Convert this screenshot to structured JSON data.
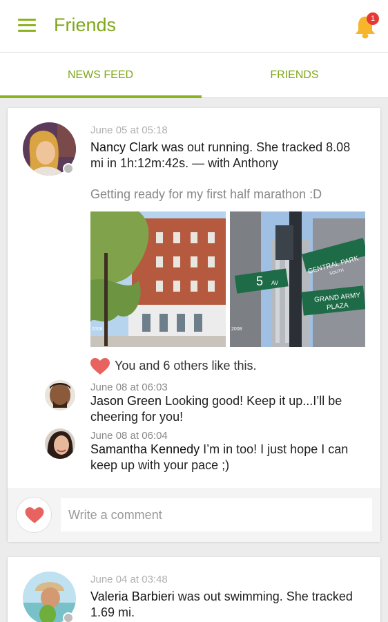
{
  "app": {
    "title": "Friends",
    "accent_color": "#8bb31f",
    "notification_count": "1"
  },
  "tabs": [
    {
      "label": "NEWS FEED",
      "active": true
    },
    {
      "label": "FRIENDS",
      "active": false
    }
  ],
  "posts": [
    {
      "timestamp": "June 05 at 05:18",
      "author": "Nancy Clark",
      "activity_text": " was out running. She tracked 8.08 mi in 1h:12m:42s. — with Anthony",
      "caption": "Getting ready for my first half marathon :D",
      "photos": [
        {
          "description": "building-street-photo",
          "watermark": "2008"
        },
        {
          "description": "street-signs-photo",
          "watermark": "2008",
          "signs": [
            "5",
            "AV",
            "CENTRAL PARK",
            "SOUTH",
            "GRAND ARMY",
            "PLAZA"
          ]
        }
      ],
      "likes_text": "You and 6 others like this.",
      "comments": [
        {
          "time": "June 08 at 06:03",
          "author": "Jason Green",
          "text": " Looking good! Keep it up...I’ll be cheering for you!"
        },
        {
          "time": "June 08 at 06:04",
          "author": "Samantha Kennedy",
          "text": " I’m in too! I just hope I can keep up with your pace ;)"
        }
      ],
      "comment_placeholder": "Write a comment"
    },
    {
      "timestamp": "June 04 at 03:48",
      "author": "Valeria Barbieri",
      "activity_text": " was out swimming. She tracked 1.69 mi."
    }
  ]
}
